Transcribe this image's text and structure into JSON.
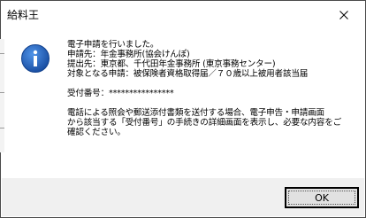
{
  "window": {
    "title": "給料王"
  },
  "message": {
    "lines": [
      "電子申請を行いました。",
      "申請先：年金事務所(協会けんぽ)",
      "提出先：東京都、千代田年金事務所 (東京事務センター)",
      "対象となる申請：被保険者資格取得届／７０歳以上被用者該当届",
      "受付番号：****************",
      "電話による照会や郵送添付書類を送付する場合、電子申告・申請画面",
      "から該当する「受付番号」の手続きの詳細画面を表示し、必要な内容をご",
      "確認ください。"
    ]
  },
  "buttons": {
    "ok_label": "OK"
  },
  "icons": {
    "dialog": "info-icon",
    "close": "close-icon"
  },
  "colors": {
    "info_blue": "#1d5fb6",
    "footer_bg": "#f0f0f0"
  }
}
